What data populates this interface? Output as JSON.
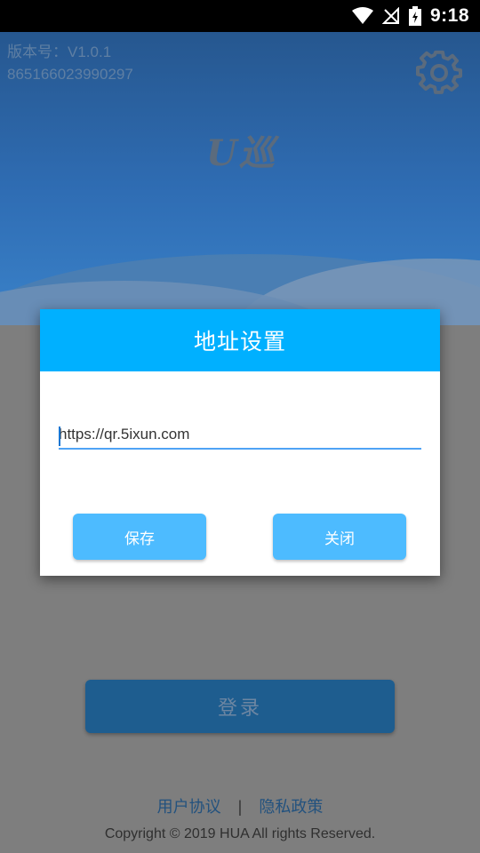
{
  "status_bar": {
    "time": "9:18",
    "icons": [
      "wifi-icon",
      "no-signal-icon",
      "battery-charging-icon"
    ]
  },
  "header": {
    "version_label": "版本号：V1.0.1",
    "device_id": "865166023990297",
    "logo_text": "U巡",
    "settings_icon": "gear-icon"
  },
  "login": {
    "button_label": "登录"
  },
  "footer": {
    "user_agreement": "用户协议",
    "separator": "|",
    "privacy_policy": "隐私政策",
    "copyright": "Copyright © 2019 HUA All rights Reserved."
  },
  "dialog": {
    "title": "地址设置",
    "url_value": "https://qr.5ixun.com",
    "save_label": "保存",
    "close_label": "关闭"
  },
  "colors": {
    "dialog_header": "#00b0ff",
    "dialog_button": "#4dbbff",
    "input_underline": "#4fa3f5",
    "overlay_dim": "#7e7e7e"
  }
}
